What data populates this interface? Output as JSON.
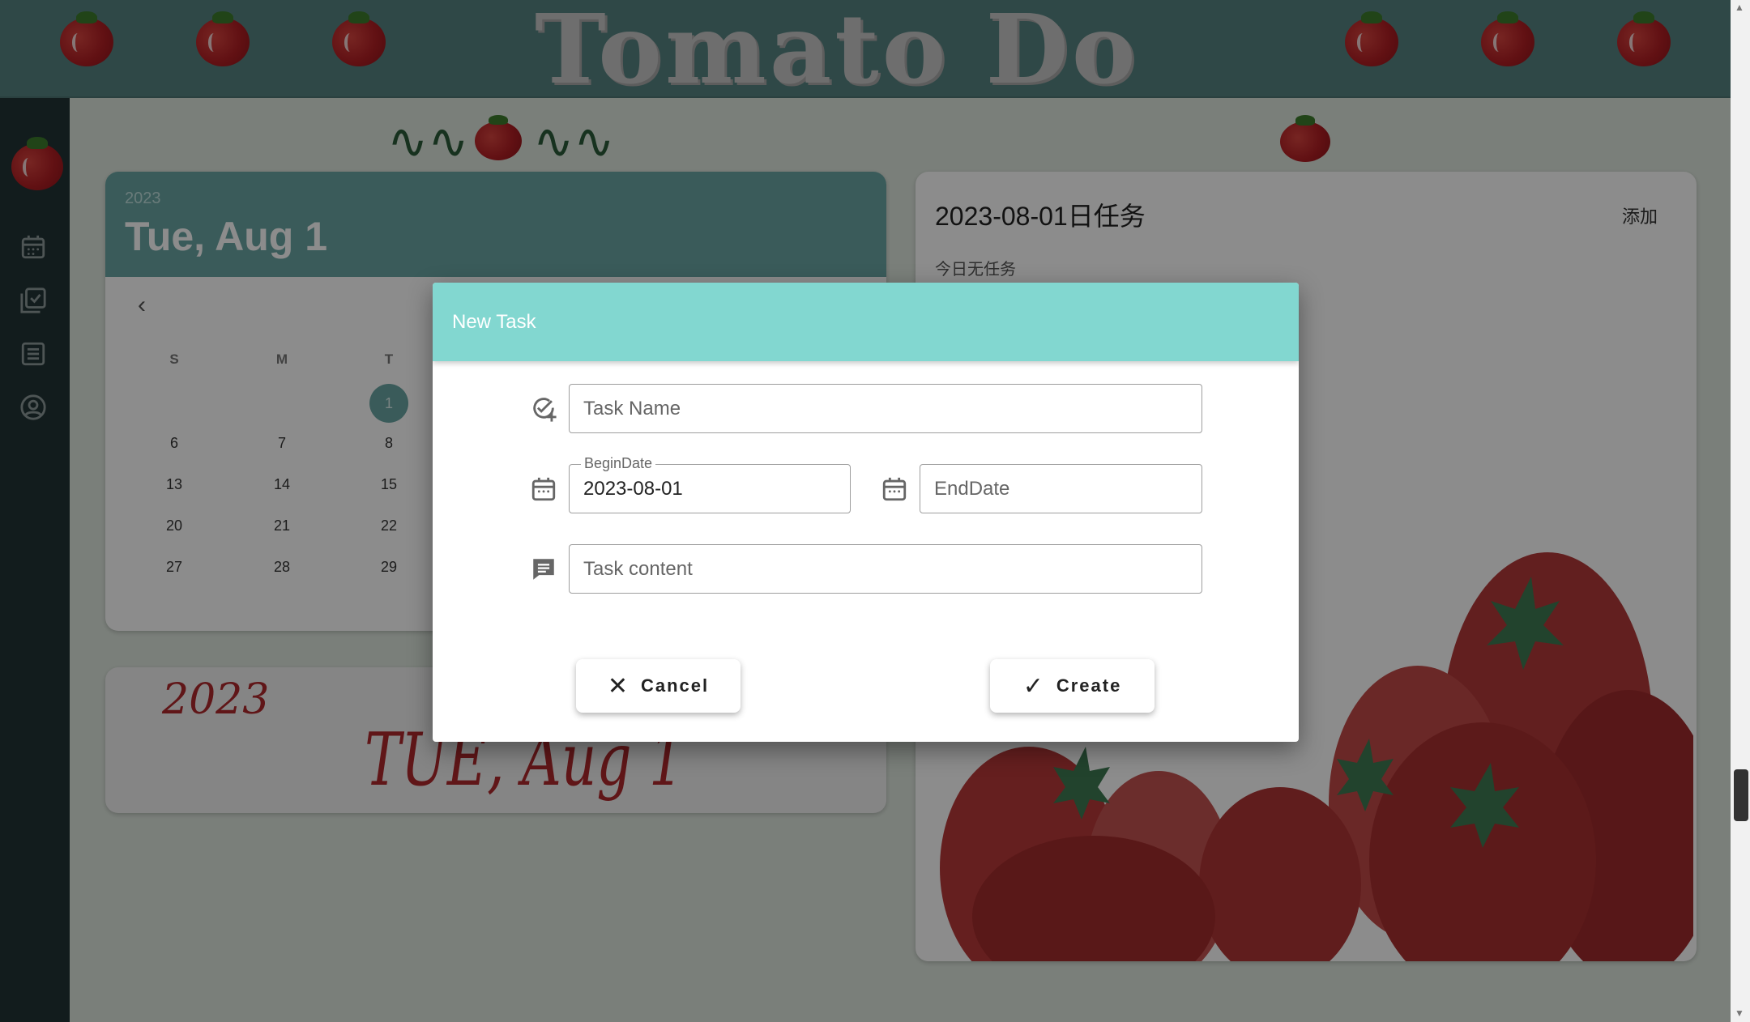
{
  "header": {
    "title": "Tomato Do"
  },
  "sidebar": {
    "items": [
      {
        "icon": "calendar-icon"
      },
      {
        "icon": "task-check-icon"
      },
      {
        "icon": "list-icon"
      },
      {
        "icon": "account-icon"
      }
    ]
  },
  "calendar": {
    "year": "2023",
    "date_label": "Tue, Aug 1",
    "weekdays": [
      "S",
      "M",
      "T"
    ],
    "rows": [
      [
        "",
        "",
        "1"
      ],
      [
        "6",
        "7",
        "8"
      ],
      [
        "13",
        "14",
        "15"
      ],
      [
        "20",
        "21",
        "22"
      ],
      [
        "27",
        "28",
        "29"
      ]
    ]
  },
  "date_card": {
    "year": "2023",
    "date": "TUE, Aug 1"
  },
  "tasks": {
    "title": "2023-08-01日任务",
    "add_label": "添加",
    "empty_text": "今日无任务"
  },
  "dialog": {
    "title": "New Task",
    "task_name_placeholder": "Task Name",
    "begin_date_label": "BeginDate",
    "begin_date_value": "2023-08-01",
    "end_date_placeholder": "EndDate",
    "task_content_placeholder": "Task content",
    "cancel_label": "Cancel",
    "create_label": "Create"
  },
  "colors": {
    "header": "#568482",
    "sidebar": "#213335",
    "calendar_accent": "#6aa7a4",
    "dialog_header": "#82d7d0",
    "tomato_red": "#b21f24"
  }
}
